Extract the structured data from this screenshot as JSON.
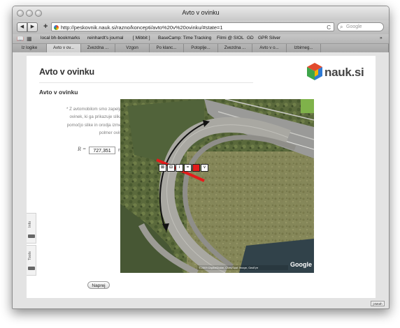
{
  "window": {
    "title": "Avto v ovinku"
  },
  "toolbar": {
    "back_label": "◀",
    "forward_label": "▶",
    "add_label": "+",
    "url": "http://peskovnik.nauk.si/razno/koncepti/avto%20v%20ovinku/#state=1",
    "reload_label": "C",
    "search_placeholder": "Google",
    "search_icon": "search-icon"
  },
  "bookmarks": [
    "local bh-bookmarks",
    "reinhardt's journal",
    "[ Mibbit ]",
    "BaseCamp: Time Tracking",
    "Filmi @ SIOL",
    "GD",
    "GPR Silver"
  ],
  "tabs": [
    {
      "label": "Iz logike",
      "active": false
    },
    {
      "label": "Avto v ov...",
      "active": true
    },
    {
      "label": "Zvezdna ...",
      "active": false
    },
    {
      "label": "Vzgon",
      "active": false
    },
    {
      "label": "Po klanc...",
      "active": false
    },
    {
      "label": "Potoplje...",
      "active": false
    },
    {
      "label": "Zvezdna ...",
      "active": false
    },
    {
      "label": "Avto v o...",
      "active": false
    },
    {
      "label": "Izbirneg...",
      "active": false
    }
  ],
  "page": {
    "title": "Avto v ovinku",
    "logo_text": "nauk.si",
    "subtitle": "Avto v ovinku",
    "instructions": "* Z avtomobilom smo zapeljali v ovinek, ki ga prikazuje slika. S pomočjo slike in orodja izmerite polmer ovinka.",
    "radius_label": "R =",
    "radius_value": "727,351",
    "radius_unit": "m",
    "next_button": "Naprej",
    "side_tabs": {
      "info": "Info",
      "tools": "Tools"
    }
  },
  "map": {
    "watermark": "Google",
    "copyright": "©2009 DigitalGlobe, Cnes/Spot Image, GeoEye",
    "ruler_buttons": [
      "⊠",
      "⊟",
      "i",
      "=",
      "■",
      "v"
    ]
  },
  "jsmath_label": "jsMath",
  "colors": {
    "accent": "#1a1a1a",
    "ruler": "#e41b1b",
    "logo_red": "#e24a2d",
    "logo_green": "#3ea54a",
    "logo_blue": "#2f7bd6",
    "logo_orange": "#f4b400"
  }
}
